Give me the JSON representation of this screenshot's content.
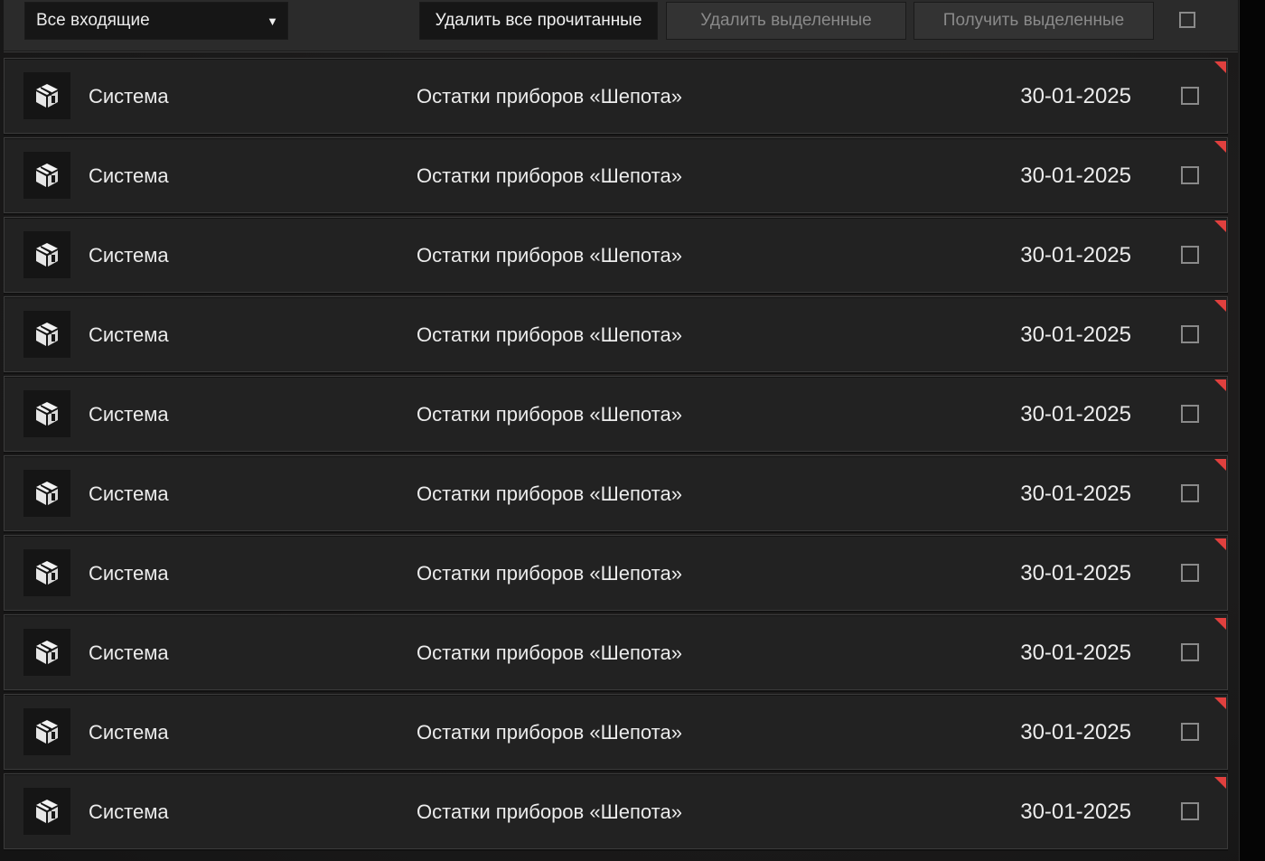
{
  "toolbar": {
    "filter_value": "Все входящие",
    "delete_read_label": "Удалить все прочитанные",
    "delete_selected_label": "Удалить выделенные",
    "get_selected_label": "Получить выделенные"
  },
  "colors": {
    "unread_flag": "#e0403e",
    "row_background": "#222222",
    "text": "#ececec",
    "disabled_text": "#8a8a8a"
  },
  "messages": [
    {
      "icon": "package-icon",
      "sender": "Система",
      "subject": "Остатки приборов «Шепота»",
      "date": "30-01-2025",
      "unread": true
    },
    {
      "icon": "package-icon",
      "sender": "Система",
      "subject": "Остатки приборов «Шепота»",
      "date": "30-01-2025",
      "unread": true
    },
    {
      "icon": "package-icon",
      "sender": "Система",
      "subject": "Остатки приборов «Шепота»",
      "date": "30-01-2025",
      "unread": true
    },
    {
      "icon": "package-icon",
      "sender": "Система",
      "subject": "Остатки приборов «Шепота»",
      "date": "30-01-2025",
      "unread": true
    },
    {
      "icon": "package-icon",
      "sender": "Система",
      "subject": "Остатки приборов «Шепота»",
      "date": "30-01-2025",
      "unread": true
    },
    {
      "icon": "package-icon",
      "sender": "Система",
      "subject": "Остатки приборов «Шепота»",
      "date": "30-01-2025",
      "unread": true
    },
    {
      "icon": "package-icon",
      "sender": "Система",
      "subject": "Остатки приборов «Шепота»",
      "date": "30-01-2025",
      "unread": true
    },
    {
      "icon": "package-icon",
      "sender": "Система",
      "subject": "Остатки приборов «Шепота»",
      "date": "30-01-2025",
      "unread": true
    },
    {
      "icon": "package-icon",
      "sender": "Система",
      "subject": "Остатки приборов «Шепота»",
      "date": "30-01-2025",
      "unread": true
    },
    {
      "icon": "package-icon",
      "sender": "Система",
      "subject": "Остатки приборов «Шепота»",
      "date": "30-01-2025",
      "unread": true
    }
  ]
}
